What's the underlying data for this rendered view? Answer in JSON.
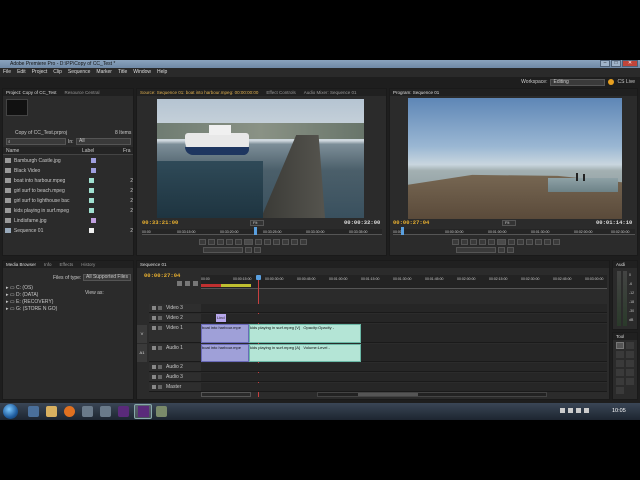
{
  "window": {
    "title": "Adobe Premiere Pro - D:\\PP\\Copy of CC_Test *",
    "buttons": [
      "–",
      "□",
      "✕"
    ]
  },
  "menu": [
    "File",
    "Edit",
    "Project",
    "Clip",
    "Sequence",
    "Marker",
    "Title",
    "Window",
    "Help"
  ],
  "workspace": {
    "label": "Workspace:",
    "value": "Editing",
    "cs_live": "CS Live"
  },
  "project_panel": {
    "tabs": [
      "Project: Copy of CC_Test",
      "Resource Central"
    ],
    "project_file": "Copy of CC_Test.prproj",
    "item_count": "8 Items",
    "search_in_label": "In:",
    "search_in_value": "All",
    "col_name": "Name",
    "col_label": "Label",
    "col_frame": "Fra",
    "items": [
      {
        "name": "Bamburgh Castle.jpg",
        "type": "image",
        "color": "#9f9fe0",
        "frame": ""
      },
      {
        "name": "Black Video",
        "type": "image",
        "color": "#9f9fe0",
        "frame": ""
      },
      {
        "name": "boat into harbour.mpeg",
        "type": "clip",
        "color": "#a0e0d0",
        "frame": "2"
      },
      {
        "name": "girl surf to beach.mpeg",
        "type": "clip",
        "color": "#a0e0d0",
        "frame": "2"
      },
      {
        "name": "girl surf to lighthouse bac",
        "type": "clip",
        "color": "#a0e0d0",
        "frame": "2"
      },
      {
        "name": "kids playing in surf.mpeg",
        "type": "clip",
        "color": "#a0e0d0",
        "frame": "2"
      },
      {
        "name": "Lindisfarne.jpg",
        "type": "image",
        "color": "#c0a0e0",
        "frame": ""
      },
      {
        "name": "Sequence 01",
        "type": "sequence",
        "color": "#f0f0f0",
        "frame": "2"
      }
    ]
  },
  "source_monitor": {
    "tabs": [
      "Source: Sequence 01: boat into harbour.mpeg: 00:00:00:00",
      "Effect Controls",
      "Audio Mixer: Sequence 01"
    ],
    "current_tc": "00:33:21:00",
    "duration_tc": "00:00:32:00",
    "fit": "Fit",
    "ruler": [
      "00:00",
      "00:33:15:00",
      "00:33:20:00",
      "00:33:25:00",
      "00:33:30:00",
      "00:33:35:00"
    ]
  },
  "program_monitor": {
    "tab": "Program: Sequence 01",
    "current_tc": "00:00:27:04",
    "duration_tc": "00:01:14:10",
    "fit": "Fit",
    "ruler": [
      "00:00",
      "00:00:30:00",
      "00:01:00:00",
      "00:01:30:00",
      "00:02:00:00",
      "00:02:30:00"
    ]
  },
  "media_browser": {
    "tabs": [
      "Media Browser",
      "Info",
      "Effects",
      "History"
    ],
    "files_of_type_label": "Files of type:",
    "files_of_type_value": "All Supported Files",
    "view_as_label": "View as:",
    "drives": [
      "C: (OS)",
      "D: (DATA)",
      "E: (RECOVERY)",
      "G: (STORE N GO)"
    ]
  },
  "timeline": {
    "tab": "Sequence 01",
    "current_tc": "00:00:27:04",
    "ruler": [
      "00:00",
      "00:00:15:00",
      "00:00:30:00",
      "00:00:45:00",
      "00:01:00:00",
      "00:01:15:00",
      "00:01:30:00",
      "00:01:45:00",
      "00:02:00:00",
      "00:02:15:00",
      "00:02:30:00",
      "00:02:45:00",
      "00:03:00:00"
    ],
    "tracks": [
      "Video 3",
      "Video 2",
      "Video 1",
      "Audio 1",
      "Audio 2",
      "Audio 3",
      "Master"
    ],
    "clips": {
      "title": "Lind",
      "v1_a": "boat into harbour.mpe",
      "v1_b": "kids playing in surf.mpeg [V]",
      "v1_b_fx": "Opacity:Opacity -",
      "a1_a": "boat into harbour.mpe",
      "a1_b": "kids playing in surf.mpeg [A]",
      "a1_b_fx": "Volume:Level -"
    }
  },
  "audio_meters": {
    "tab": "Audi",
    "labels": [
      "0",
      "-6",
      "-12",
      "-18",
      "-30",
      "dB"
    ]
  },
  "tools": {
    "tab": "Tool"
  },
  "taskbar": {
    "clock": "10:05"
  }
}
